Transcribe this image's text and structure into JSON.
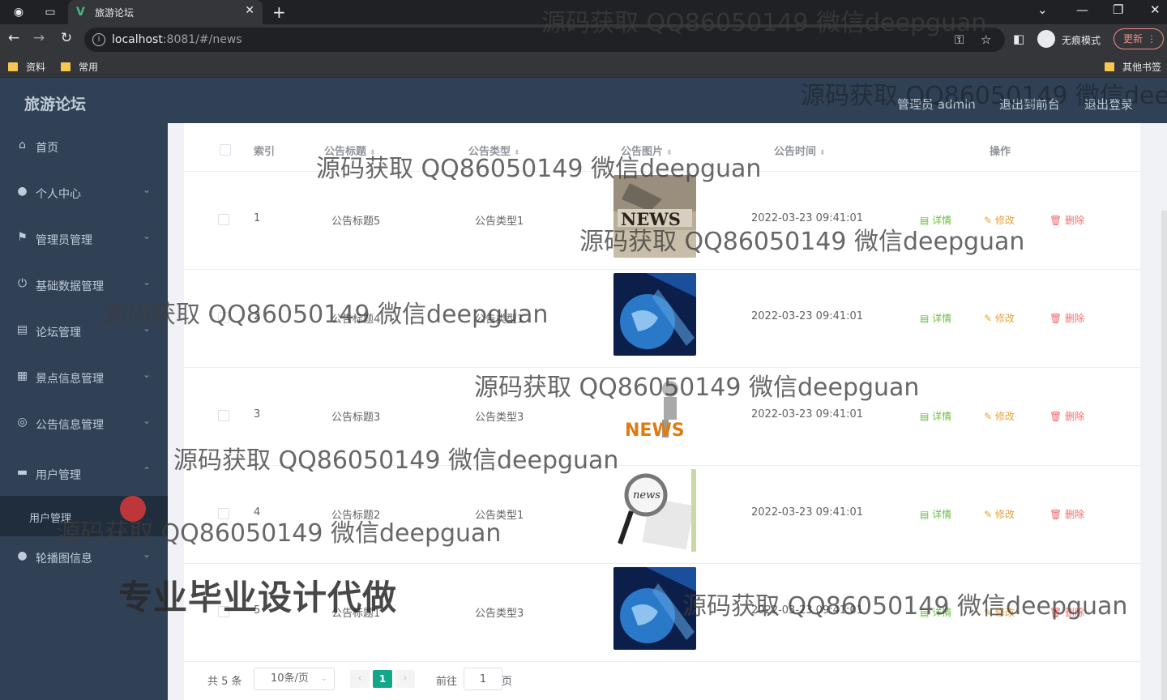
{
  "browser": {
    "tab_title": "旅游论坛",
    "url_host": "localhost",
    "url_rest": ":8081/#/news",
    "incognito_label": "无痕模式",
    "update_label": "更新",
    "bookmarks": [
      "资料",
      "常用"
    ],
    "other_bookmarks": "其他书签"
  },
  "header": {
    "brand": "旅游论坛",
    "admin_label": "管理员 admin",
    "back_frontend": "退出到前台",
    "logout": "退出登录"
  },
  "sidebar": {
    "items": [
      {
        "label": "首页",
        "icon": "home-icon"
      },
      {
        "label": "个人中心",
        "icon": "user-icon"
      },
      {
        "label": "管理员管理",
        "icon": "flag-icon"
      },
      {
        "label": "基础数据管理",
        "icon": "power-icon"
      },
      {
        "label": "论坛管理",
        "icon": "board-icon"
      },
      {
        "label": "景点信息管理",
        "icon": "grid-icon"
      },
      {
        "label": "公告信息管理",
        "icon": "globe-icon"
      },
      {
        "label": "用户管理",
        "icon": "group-icon"
      }
    ],
    "sub_item": "用户管理",
    "last_item": {
      "label": "轮播图信息",
      "icon": "user-icon"
    }
  },
  "table": {
    "headers": {
      "index": "索引",
      "title": "公告标题",
      "type": "公告类型",
      "image": "公告图片",
      "time": "公告时间",
      "actions": "操作"
    },
    "rows": [
      {
        "index": "1",
        "title": "公告标题5",
        "type": "公告类型1",
        "time": "2022-03-23 09:41:01",
        "image": "news-letters-photo"
      },
      {
        "index": "2",
        "title": "公告标题4",
        "type": "公告类型1",
        "time": "2022-03-23 09:41:01",
        "image": "globe-news-photo"
      },
      {
        "index": "3",
        "title": "公告标题3",
        "type": "公告类型3",
        "time": "2022-03-23 09:41:01",
        "image": "news-figure-photo"
      },
      {
        "index": "4",
        "title": "公告标题2",
        "type": "公告类型1",
        "time": "2022-03-23 09:41:01",
        "image": "magnifier-news-photo"
      },
      {
        "index": "5",
        "title": "公告标题1",
        "type": "公告类型3",
        "time": "2022-03-23 09:41:01",
        "image": "globe-news-photo"
      }
    ],
    "actions": {
      "detail": "详情",
      "edit": "修改",
      "delete": "删除"
    }
  },
  "pagination": {
    "total": "共 5 条",
    "page_size": "10条/页",
    "current_page": "1",
    "goto_label": "前往",
    "goto_value": "1",
    "page_unit": "页"
  },
  "watermarks": {
    "text": "源码获取 QQ86050149 微信deepguan",
    "text_clipped": "源码获取 QQ86050149 微信deep",
    "promo": "专业毕业设计代做"
  },
  "colors": {
    "sidebar_bg": "#304156",
    "primary": "#13a689",
    "detail": "#67c23a",
    "edit": "#e6a23c",
    "delete": "#f56c6c"
  }
}
